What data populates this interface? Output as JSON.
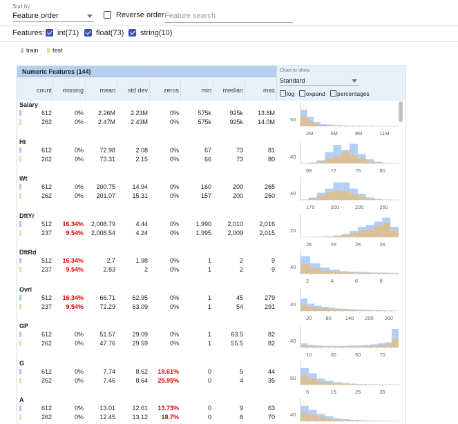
{
  "sort": {
    "label": "Sort by",
    "value": "Feature order"
  },
  "reverse": {
    "label": "Reverse order",
    "checked": false
  },
  "search": {
    "placeholder": "Feature search"
  },
  "features_filter": {
    "label": "Features:",
    "items": [
      {
        "label": "int(71)",
        "checked": true
      },
      {
        "label": "float(73)",
        "checked": true
      },
      {
        "label": "string(10)",
        "checked": true
      }
    ]
  },
  "legend": [
    {
      "label": "train",
      "color": "#a8c5f5"
    },
    {
      "label": "test",
      "color": "#f3d59a"
    }
  ],
  "table": {
    "title": "Numeric Features (144)",
    "columns": [
      "count",
      "missing",
      "mean",
      "std dev",
      "zeros",
      "min",
      "median",
      "max"
    ],
    "chart_to_show_label": "Chart to show",
    "chart_select": "Standard",
    "options": [
      "log",
      "expand",
      "percentages"
    ]
  },
  "features": [
    {
      "name": "Salary",
      "train": [
        "612",
        "0%",
        "2.26M",
        "2.23M",
        "0%",
        "575k",
        "925k",
        "13.8M"
      ],
      "test": [
        "262",
        "0%",
        "2.47M",
        "2.43M",
        "0%",
        "575k",
        "925k",
        "14.0M"
      ],
      "red_missing": false,
      "red_zeros": false,
      "y_tick": "50",
      "x_ticks": [
        "2M",
        "5M",
        "8M",
        "11M"
      ],
      "train_hist": [
        0.8,
        0.45,
        0.2,
        0.1,
        0.08,
        0.05,
        0.04,
        0.03,
        0.03,
        0.02,
        0.02,
        0.015,
        0.01,
        0.01,
        0.01
      ],
      "test_hist": [
        0.5,
        0.25,
        0.12,
        0.06,
        0.05,
        0.03,
        0.02,
        0.02,
        0.015,
        0.01,
        0.01,
        0.01,
        0.005,
        0.005,
        0.005
      ]
    },
    {
      "name": "Ht",
      "train": [
        "612",
        "0%",
        "72.98",
        "2.08",
        "0%",
        "67",
        "73",
        "81"
      ],
      "test": [
        "262",
        "0%",
        "73.31",
        "2.15",
        "0%",
        "66",
        "73",
        "80"
      ],
      "red_missing": false,
      "red_zeros": false,
      "y_tick": "40",
      "x_ticks": [
        "68",
        "72",
        "76",
        "80"
      ],
      "train_hist": [
        0.02,
        0.05,
        0.15,
        0.55,
        0.9,
        0.65,
        0.95,
        0.45,
        0.2,
        0.08,
        0.03,
        0.01
      ],
      "test_hist": [
        0.01,
        0.03,
        0.1,
        0.25,
        0.35,
        0.55,
        0.4,
        0.25,
        0.1,
        0.04,
        0.02,
        0.0
      ]
    },
    {
      "name": "Wt",
      "train": [
        "612",
        "0%",
        "200.75",
        "14.94",
        "0%",
        "160",
        "200",
        "265"
      ],
      "test": [
        "262",
        "0%",
        "201.07",
        "15.31",
        "0%",
        "157",
        "200",
        "260"
      ],
      "red_missing": false,
      "red_zeros": false,
      "y_tick": "40",
      "x_ticks": [
        "170",
        "200",
        "230",
        "260"
      ],
      "train_hist": [
        0.02,
        0.12,
        0.35,
        0.55,
        0.85,
        0.85,
        0.55,
        0.3,
        0.12,
        0.05,
        0.02,
        0.01
      ],
      "test_hist": [
        0.01,
        0.05,
        0.2,
        0.35,
        0.45,
        0.4,
        0.3,
        0.15,
        0.06,
        0.02,
        0.01,
        0.0
      ]
    },
    {
      "name": "DftYr",
      "train": [
        "512",
        "16.34%",
        "2,008.79",
        "4.44",
        "0%",
        "1,990",
        "2,010",
        "2,016"
      ],
      "test": [
        "237",
        "9.54%",
        "2,008.54",
        "4.24",
        "0%",
        "1,995",
        "2,009",
        "2,015"
      ],
      "red_missing": true,
      "red_zeros": false,
      "y_tick": "20",
      "x_ticks": [
        "2K",
        "2K",
        "2K",
        "2K"
      ],
      "train_hist": [
        0.0,
        0.01,
        0.02,
        0.04,
        0.08,
        0.15,
        0.3,
        0.5,
        0.6,
        0.75,
        0.95,
        0.5
      ],
      "test_hist": [
        0.0,
        0.01,
        0.01,
        0.02,
        0.05,
        0.1,
        0.18,
        0.3,
        0.35,
        0.55,
        0.7,
        0.3
      ]
    },
    {
      "name": "DftRd",
      "train": [
        "512",
        "16.34%",
        "2.7",
        "1.98",
        "0%",
        "1",
        "2",
        "9"
      ],
      "test": [
        "237",
        "9.54%",
        "2.83",
        "2",
        "0%",
        "1",
        "2",
        "9"
      ],
      "red_missing": true,
      "red_zeros": false,
      "y_tick": "40",
      "x_ticks": [
        "2",
        "4",
        "6",
        "8"
      ],
      "train_hist": [
        0.85,
        0.5,
        0.3,
        0.2,
        0.12,
        0.1,
        0.08,
        0.06,
        0.05,
        0.04
      ],
      "test_hist": [
        0.45,
        0.25,
        0.15,
        0.1,
        0.06,
        0.05,
        0.04,
        0.03,
        0.03,
        0.02
      ]
    },
    {
      "name": "Ovrl",
      "train": [
        "512",
        "16.34%",
        "66.71",
        "62.95",
        "0%",
        "1",
        "45",
        "279"
      ],
      "test": [
        "237",
        "9.54%",
        "72.29",
        "63.09",
        "0%",
        "1",
        "54",
        "291"
      ],
      "red_missing": true,
      "red_zeros": false,
      "y_tick": "40",
      "x_ticks": [
        "20",
        "80",
        "140",
        "200",
        "260"
      ],
      "train_hist": [
        0.6,
        0.35,
        0.25,
        0.2,
        0.15,
        0.12,
        0.1,
        0.08,
        0.06,
        0.05,
        0.04,
        0.03,
        0.02,
        0.01
      ],
      "test_hist": [
        0.3,
        0.2,
        0.15,
        0.12,
        0.1,
        0.08,
        0.07,
        0.05,
        0.04,
        0.03,
        0.02,
        0.02,
        0.01,
        0.01
      ]
    },
    {
      "name": "GP",
      "train": [
        "612",
        "0%",
        "51.57",
        "29.09",
        "0%",
        "1",
        "63.5",
        "82"
      ],
      "test": [
        "262",
        "0%",
        "47.76",
        "29.59",
        "0%",
        "1",
        "55.5",
        "82"
      ],
      "red_missing": false,
      "red_zeros": false,
      "y_tick": "40",
      "x_ticks": [
        "10",
        "30",
        "50",
        "70"
      ],
      "train_hist": [
        0.2,
        0.12,
        0.1,
        0.08,
        0.08,
        0.08,
        0.08,
        0.1,
        0.1,
        0.12,
        0.15,
        0.2,
        0.25,
        0.9
      ],
      "test_hist": [
        0.1,
        0.06,
        0.05,
        0.04,
        0.04,
        0.04,
        0.05,
        0.05,
        0.06,
        0.07,
        0.09,
        0.12,
        0.15,
        0.4
      ]
    },
    {
      "name": "G",
      "train": [
        "612",
        "0%",
        "7.74",
        "8.62",
        "19.61%",
        "0",
        "5",
        "44"
      ],
      "test": [
        "262",
        "0%",
        "7.46",
        "8.64",
        "25.95%",
        "0",
        "4",
        "35"
      ],
      "red_missing": false,
      "red_zeros": true,
      "y_tick": "50",
      "x_ticks": [
        "5",
        "15",
        "25",
        "35"
      ],
      "train_hist": [
        0.8,
        0.55,
        0.3,
        0.2,
        0.12,
        0.08,
        0.05,
        0.03,
        0.02,
        0.02,
        0.01,
        0.01
      ],
      "test_hist": [
        0.45,
        0.3,
        0.15,
        0.1,
        0.06,
        0.04,
        0.02,
        0.01,
        0.01,
        0.005,
        0.005,
        0.0
      ]
    },
    {
      "name": "A",
      "train": [
        "612",
        "0%",
        "13.01",
        "12.61",
        "13.73%",
        "0",
        "9",
        "63"
      ],
      "test": [
        "262",
        "0%",
        "12.45",
        "13.12",
        "18.7%",
        "0",
        "8",
        "70"
      ],
      "red_missing": false,
      "red_zeros": true,
      "y_tick": "40",
      "x_ticks": [],
      "train_hist": [
        0.75,
        0.55,
        0.35,
        0.25,
        0.15,
        0.1,
        0.07,
        0.05,
        0.03,
        0.02,
        0.01,
        0.01
      ],
      "test_hist": [
        0.4,
        0.3,
        0.2,
        0.12,
        0.08,
        0.05,
        0.03,
        0.02,
        0.01,
        0.01,
        0.005,
        0.0
      ]
    }
  ]
}
